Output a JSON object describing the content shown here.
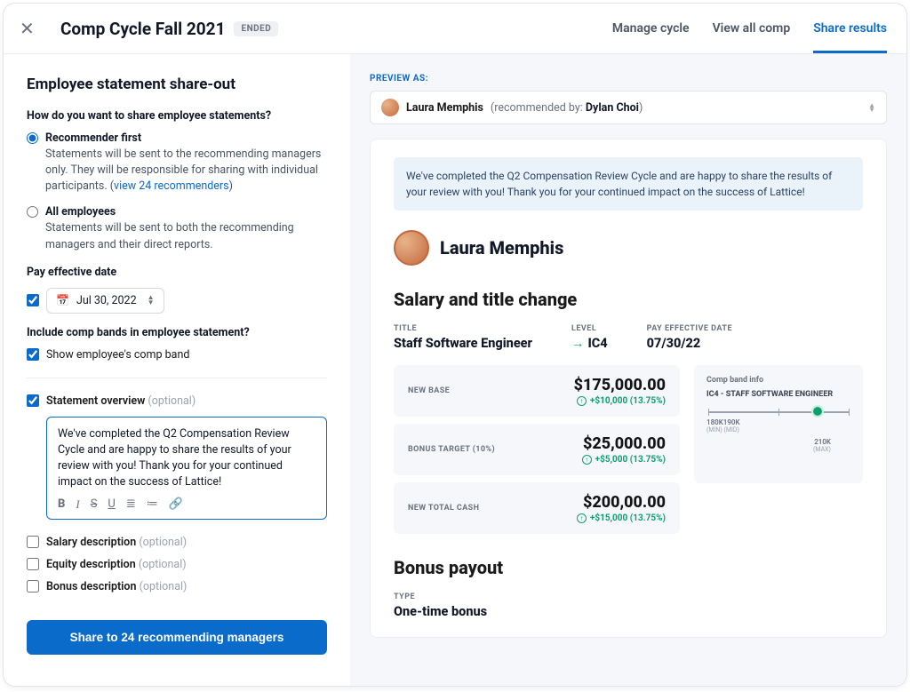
{
  "header": {
    "title": "Comp Cycle Fall 2021",
    "status_chip": "ENDED",
    "tabs": [
      "Manage cycle",
      "View all comp",
      "Share results"
    ]
  },
  "share": {
    "heading": "Employee statement share-out",
    "q_share_method": "How do you want to share employee statements?",
    "opt_recommender_title": "Recommender first",
    "opt_recommender_desc": "Statements will be sent to the recommending managers only. They will be responsible for sharing with individual participants. (",
    "opt_recommender_link": "view 24 recommenders",
    "opt_recommender_paren": ")",
    "opt_all_title": "All employees",
    "opt_all_desc": "Statements will be sent to both the recommending managers and their direct reports.",
    "pay_date_label": "Pay effective date",
    "pay_date_value": "Jul 30, 2022",
    "bands_q": "Include comp bands in employee statement?",
    "bands_ck": "Show employee's comp band",
    "stmt_overview_label": "Statement overview",
    "optional": "(optional)",
    "stmt_text": "We've completed the Q2 Compensation Review Cycle and are happy to share the results of your review with you! Thank you for your continued impact on the success of Lattice!",
    "salary_desc_label": "Salary description",
    "equity_desc_label": "Equity description",
    "bonus_desc_label": "Bonus description",
    "share_btn": "Share to 24 recommending managers"
  },
  "preview": {
    "preview_as_label": "PREVIEW AS:",
    "person_name": "Laura Memphis",
    "rec_by_text": "(recommended by:",
    "rec_by_name": "Dylan Choi",
    "rec_by_close": ")",
    "banner": "We've completed the Q2 Compensation Review Cycle and are happy to share the results of your review with you! Thank you for your continued impact on the success of Lattice!",
    "emp_name": "Laura Memphis",
    "sec1_title": "Salary and title change",
    "meta": {
      "title_label": "TITLE",
      "title_value": "Staff Software Engineer",
      "level_label": "LEVEL",
      "level_value": "IC4",
      "date_label": "PAY EFFECTIVE DATE",
      "date_value": "07/30/22"
    },
    "stats": {
      "new_base_label": "NEW BASE",
      "new_base_value": "$175,000.00",
      "new_base_delta": "+$10,000 (13.75%)",
      "bonus_label": "BONUS TARGET (10%)",
      "bonus_value": "$25,000.00",
      "bonus_delta": "+$5,000 (13.75%)",
      "total_label": "NEW TOTAL CASH",
      "total_value": "$200,00.00",
      "total_delta": "+$15,000 (13.75%)"
    },
    "band": {
      "label": "Comp band info",
      "title": "IC4 - STAFF SOFTWARE ENGINEER",
      "min_v": "180K",
      "min_t": "(MIN)",
      "mid_v": "190K",
      "mid_t": "(MID)",
      "max_v": "210K",
      "max_t": "(MAX)"
    },
    "sec2_title": "Bonus payout",
    "sec2_type_label": "TYPE",
    "sec2_type_value": "One-time bonus"
  }
}
